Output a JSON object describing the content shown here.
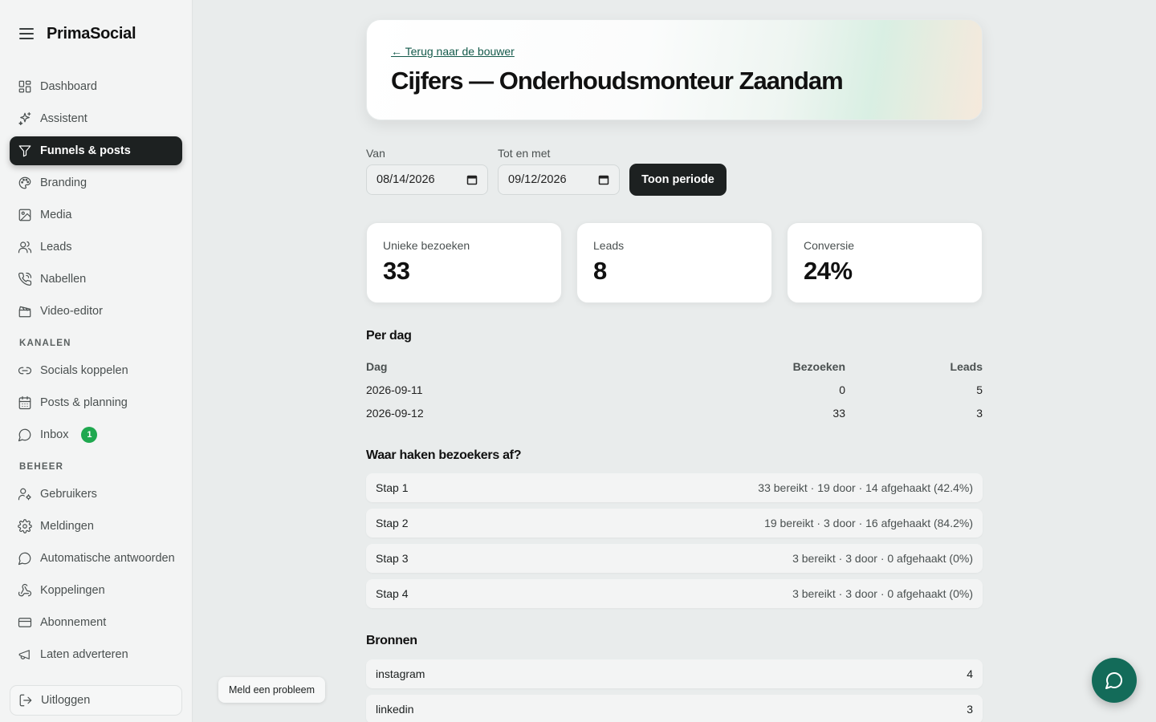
{
  "app": {
    "name": "PrimaSocial"
  },
  "nav": {
    "main": [
      {
        "label": "Dashboard"
      },
      {
        "label": "Assistent"
      },
      {
        "label": "Funnels & posts"
      },
      {
        "label": "Branding"
      },
      {
        "label": "Media"
      },
      {
        "label": "Leads"
      },
      {
        "label": "Nabellen"
      },
      {
        "label": "Video-editor"
      }
    ],
    "kanalen_label": "KANALEN",
    "kanalen": [
      {
        "label": "Socials koppelen"
      },
      {
        "label": "Posts & planning"
      },
      {
        "label": "Inbox",
        "badge": "1"
      }
    ],
    "beheer_label": "BEHEER",
    "beheer": [
      {
        "label": "Gebruikers"
      },
      {
        "label": "Meldingen"
      },
      {
        "label": "Automatische antwoorden"
      },
      {
        "label": "Koppelingen"
      },
      {
        "label": "Abonnement"
      },
      {
        "label": "Laten adverteren"
      }
    ],
    "logout": "Uitloggen",
    "active": "Funnels & posts"
  },
  "report_button": "Meld een probleem",
  "header": {
    "back_link": "← Terug naar de bouwer",
    "title": "Cijfers — Onderhoudsmonteur Zaandam"
  },
  "filters": {
    "from_label": "Van",
    "from_value": "08/14/2026",
    "to_label": "Tot en met",
    "to_value": "09/12/2026",
    "submit": "Toon periode"
  },
  "stats": [
    {
      "label": "Unieke bezoeken",
      "value": "33"
    },
    {
      "label": "Leads",
      "value": "8"
    },
    {
      "label": "Conversie",
      "value": "24%"
    }
  ],
  "per_day": {
    "title": "Per dag",
    "headers": [
      "Dag",
      "Bezoeken",
      "Leads"
    ],
    "rows": [
      [
        "2026-09-11",
        "0",
        "5"
      ],
      [
        "2026-09-12",
        "33",
        "3"
      ]
    ]
  },
  "dropoff": {
    "title": "Waar haken bezoekers af?",
    "steps": [
      {
        "label": "Stap 1",
        "detail": "33 bereikt · 19 door · 14 afgehaakt (42.4%)"
      },
      {
        "label": "Stap 2",
        "detail": "19 bereikt · 3 door · 16 afgehaakt (84.2%)"
      },
      {
        "label": "Stap 3",
        "detail": "3 bereikt · 3 door · 0 afgehaakt (0%)"
      },
      {
        "label": "Stap 4",
        "detail": "3 bereikt · 3 door · 0 afgehaakt (0%)"
      }
    ]
  },
  "sources": {
    "title": "Bronnen",
    "items": [
      {
        "label": "instagram",
        "value": "4"
      },
      {
        "label": "linkedin",
        "value": "3"
      }
    ]
  },
  "colors": {
    "active_nav": "#1d2121",
    "badge": "#1fa84f",
    "link": "#145a4b",
    "fab": "#136b59"
  }
}
